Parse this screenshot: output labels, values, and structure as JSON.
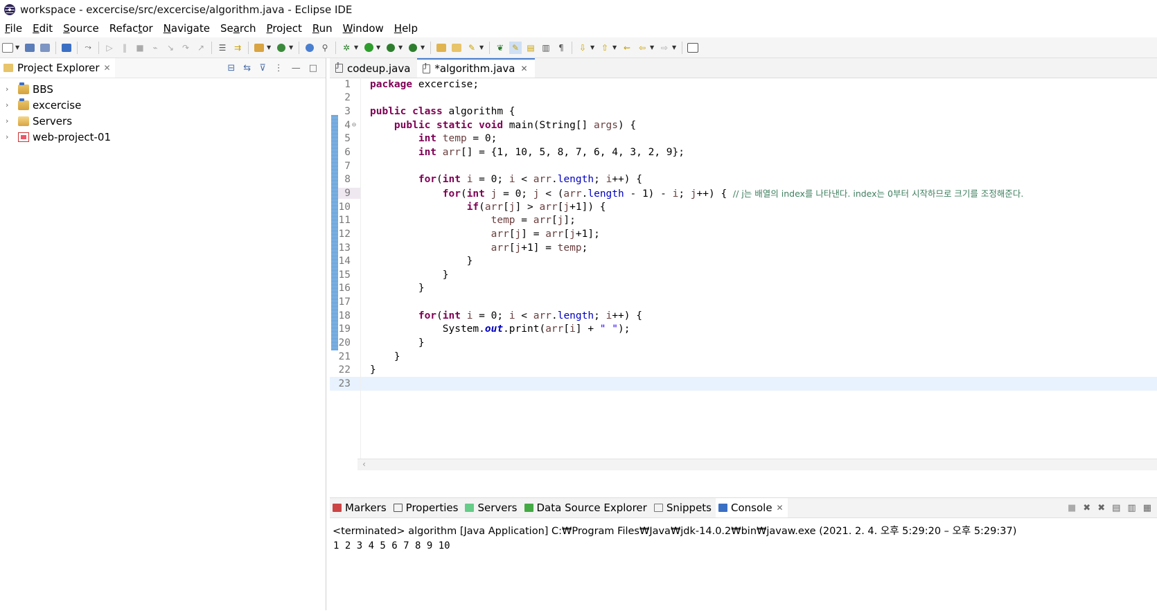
{
  "window": {
    "title": "workspace - excercise/src/excercise/algorithm.java - Eclipse IDE"
  },
  "menu": [
    {
      "pre": "",
      "mn": "F",
      "post": "ile"
    },
    {
      "pre": "",
      "mn": "E",
      "post": "dit"
    },
    {
      "pre": "",
      "mn": "S",
      "post": "ource"
    },
    {
      "pre": "Refac",
      "mn": "t",
      "post": "or"
    },
    {
      "pre": "",
      "mn": "N",
      "post": "avigate"
    },
    {
      "pre": "Se",
      "mn": "a",
      "post": "rch"
    },
    {
      "pre": "",
      "mn": "P",
      "post": "roject"
    },
    {
      "pre": "",
      "mn": "R",
      "post": "un"
    },
    {
      "pre": "",
      "mn": "W",
      "post": "indow"
    },
    {
      "pre": "",
      "mn": "H",
      "post": "elp"
    }
  ],
  "project_explorer": {
    "title": "Project Explorer",
    "items": [
      {
        "label": "BBS",
        "icon": "java-project-icon"
      },
      {
        "label": "excercise",
        "icon": "java-project-icon"
      },
      {
        "label": "Servers",
        "icon": "folder-icon"
      },
      {
        "label": "web-project-01",
        "icon": "web-project-icon"
      }
    ]
  },
  "editor": {
    "tabs": [
      {
        "label": "codeup.java",
        "active": false
      },
      {
        "label": "*algorithm.java",
        "active": true
      }
    ],
    "current_line": 9,
    "line_numbers": [
      "1",
      "2",
      "3",
      "4",
      "5",
      "6",
      "7",
      "8",
      "9",
      "10",
      "11",
      "12",
      "13",
      "14",
      "15",
      "16",
      "17",
      "18",
      "19",
      "20",
      "21",
      "22",
      "23"
    ]
  },
  "bottom_panel": {
    "tabs": [
      "Markers",
      "Properties",
      "Servers",
      "Data Source Explorer",
      "Snippets",
      "Console"
    ],
    "active_tab": "Console",
    "console_status": "<terminated> algorithm [Java Application] C:₩Program Files₩Java₩jdk-14.0.2₩bin₩javaw.exe  (2021. 2. 4. 오후 5:29:20 – 오후 5:29:37)",
    "console_output": "1 2 3 4 5 6 7 8 9 10"
  },
  "colors": {
    "keyword": "#7f0055",
    "field": "#0000c0",
    "string": "#2a00ff",
    "comment": "#3f7f5f",
    "local_var": "#6a3e3e",
    "active_tab_accent": "#4a7fd0"
  }
}
